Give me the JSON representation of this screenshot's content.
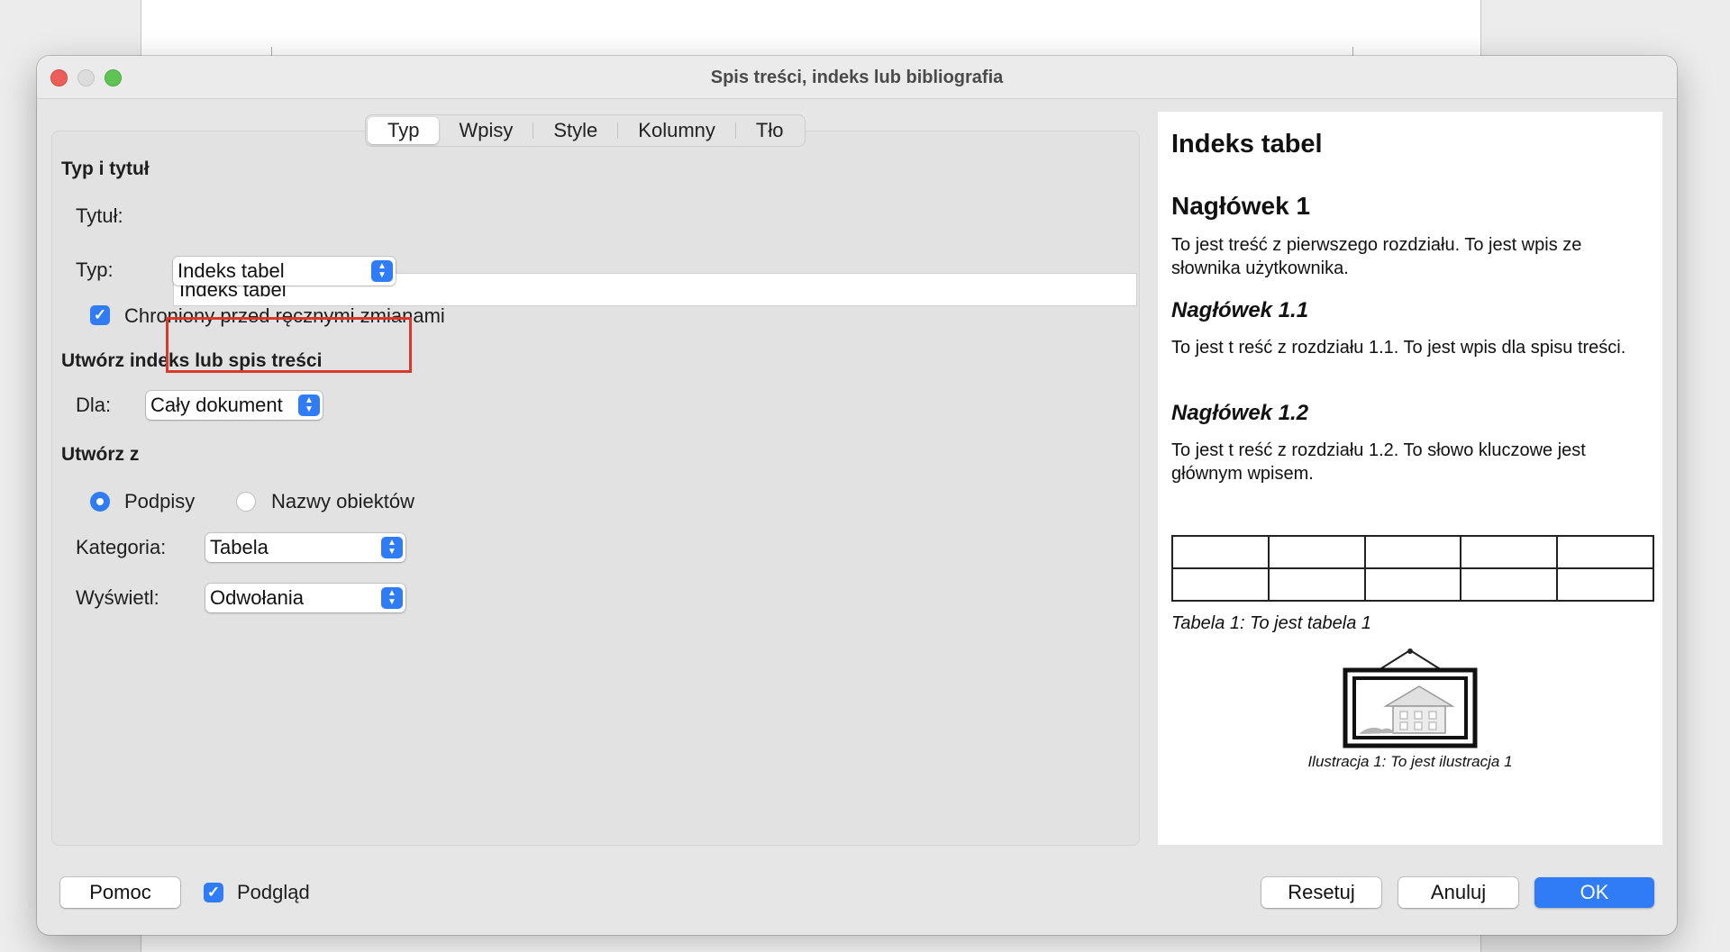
{
  "dialog": {
    "title": "Spis treści, indeks lub bibliografia"
  },
  "tabs": [
    {
      "label": "Typ",
      "active": true
    },
    {
      "label": "Wpisy"
    },
    {
      "label": "Style"
    },
    {
      "label": "Kolumny"
    },
    {
      "label": "Tło"
    }
  ],
  "type_section": {
    "heading": "Typ i tytuł",
    "title_label": "Tytuł:",
    "title_value": "Indeks tabel",
    "type_label": "Typ:",
    "type_value": "Indeks tabel",
    "protected_label": "Chroniony przed ręcznymi zmianami",
    "protected_checked": true
  },
  "create_section": {
    "heading": "Utwórz indeks lub spis treści",
    "for_label": "Dla:",
    "for_value": "Cały dokument"
  },
  "from_section": {
    "heading": "Utwórz z",
    "radio_captions": "Podpisy",
    "radio_object_names": "Nazwy obiektów",
    "selected": "Podpisy",
    "category_label": "Kategoria:",
    "category_value": "Tabela",
    "display_label": "Wyświetl:",
    "display_value": "Odwołania"
  },
  "preview": {
    "title": "Indeks tabel",
    "h1": "Nagłówek 1",
    "p1": "To jest  treść z pierwszego rozdziału. To jest wpis ze słownika użytkownika.",
    "h11": "Nagłówek 1.1",
    "p11": "To jest t reść z rozdziału 1.1. To jest wpis dla spisu treści.",
    "h12": "Nagłówek 1.2",
    "p12": "To jest t reść z rozdziału 1.2. To słowo kluczowe jest głównym wpisem.",
    "table_caption": "Tabela 1: To jest tabela 1",
    "illustration_caption": "Ilustracja 1: To jest ilustracja 1"
  },
  "footer": {
    "help": "Pomoc",
    "preview_label": "Podgląd",
    "preview_checked": true,
    "reset": "Resetuj",
    "cancel": "Anuluj",
    "ok": "OK"
  },
  "colors": {
    "accent": "#2f7cf6",
    "highlight": "#d9382b"
  }
}
